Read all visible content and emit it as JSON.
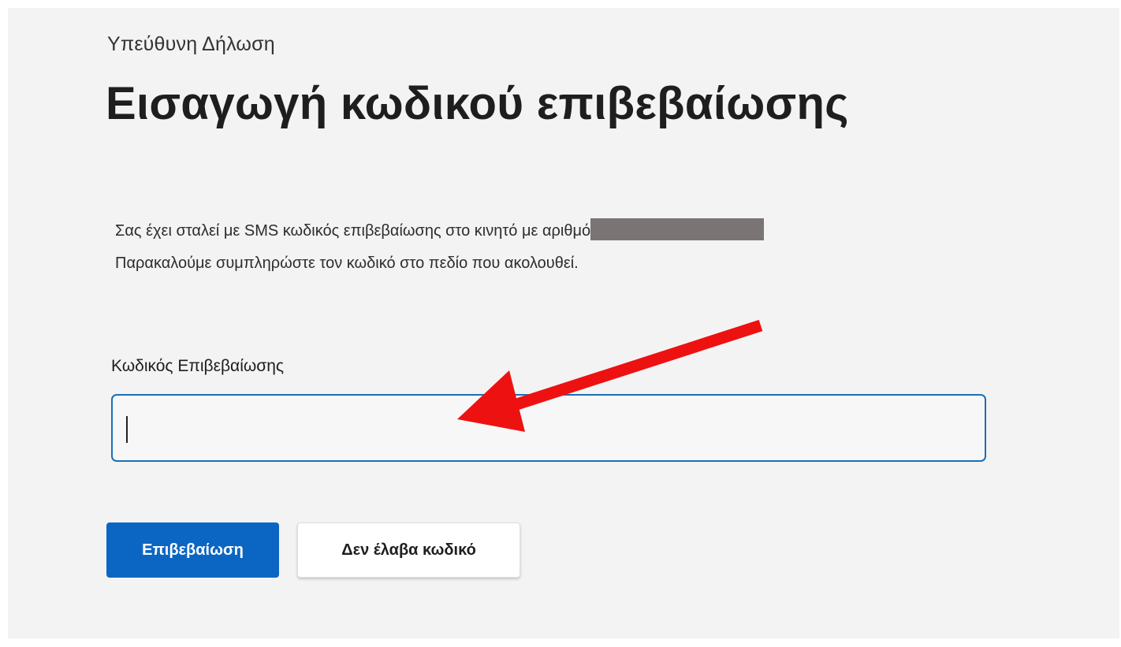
{
  "page": {
    "caption": "Υπεύθυνη Δήλωση",
    "title": "Εισαγωγή κωδικού επιβεβαίωσης",
    "description_line1": "Σας έχει σταλεί με SMS κωδικός επιβεβαίωσης στο κινητό με αριθμό",
    "description_line2": "Παρακαλούμε συμπληρώστε τον κωδικό στο πεδίο που ακολουθεί."
  },
  "form": {
    "code_label": "Κωδικός Επιβεβαίωσης",
    "code_value": "",
    "confirm_label": "Επιβεβαίωση",
    "not_received_label": "Δεν έλαβα κωδικό"
  },
  "colors": {
    "accent": "#0b66c3",
    "field_border": "#1a6fb8",
    "annotation_arrow": "#ee1111",
    "redaction": "#7a7474"
  },
  "icons": {
    "annotation": "red-arrow-icon"
  }
}
